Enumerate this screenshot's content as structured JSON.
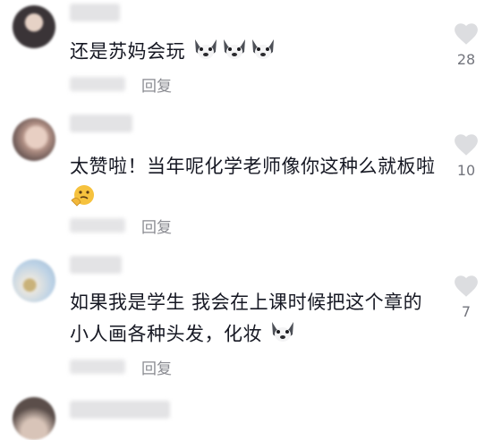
{
  "comments": [
    {
      "text": "还是苏妈会玩",
      "reply_label": "回复",
      "like_count": "28",
      "emoji_count": 3
    },
    {
      "text": "太赞啦！当年呢化学老师像你这种么就板啦",
      "reply_label": "回复",
      "like_count": "10"
    },
    {
      "text_line1": "如果我是学生 我会在上课时候把这个章的",
      "text_line2": "小人画各种头发，化妆",
      "reply_label": "回复",
      "like_count": "7"
    }
  ],
  "icons": {
    "heart": "heart-icon",
    "husky": "husky-emoji-icon",
    "thinking": "thinking-emoji-icon"
  },
  "colors": {
    "text": "#161823",
    "secondary": "#8a8b91",
    "heart": "#dcdde0"
  }
}
